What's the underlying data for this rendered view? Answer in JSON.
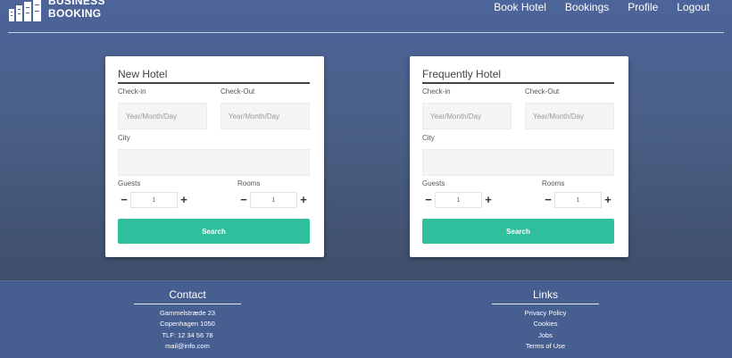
{
  "brand": {
    "line1": "BUSINESS",
    "line2": "BOOKING"
  },
  "nav": [
    "Book Hotel",
    "Bookings",
    "Profile",
    "Logout"
  ],
  "cards": [
    {
      "title": "New Hotel",
      "checkin_label": "Check-in",
      "checkout_label": "Check-Out",
      "checkin_placeholder": "Year/Month/Day",
      "checkout_placeholder": "Year/Month/Day",
      "city_label": "City",
      "guests_label": "Guests",
      "rooms_label": "Rooms",
      "guests_value": "1",
      "rooms_value": "1",
      "search_label": "Search"
    },
    {
      "title": "Frequently Hotel",
      "checkin_label": "Check-in",
      "checkout_label": "Check-Out",
      "checkin_placeholder": "Year/Month/Day",
      "checkout_placeholder": "Year/Month/Day",
      "city_label": "City",
      "guests_label": "Guests",
      "rooms_label": "Rooms",
      "guests_value": "1",
      "rooms_value": "1",
      "search_label": "Search"
    }
  ],
  "stepper": {
    "minus": "−",
    "plus": "+"
  },
  "footer": {
    "contact": {
      "title": "Contact",
      "items": [
        "Gammelstræde 23",
        "Copenhagen 1050",
        "TLF: 12 34 56 78",
        "mail@info.com"
      ]
    },
    "links": {
      "title": "Links",
      "items": [
        "Privacy Policy",
        "Cookies",
        "Jobs",
        "Terms of Use"
      ]
    }
  },
  "colors": {
    "accent": "#2fbf9c",
    "background": "#4b628e",
    "card": "#ffffff"
  }
}
